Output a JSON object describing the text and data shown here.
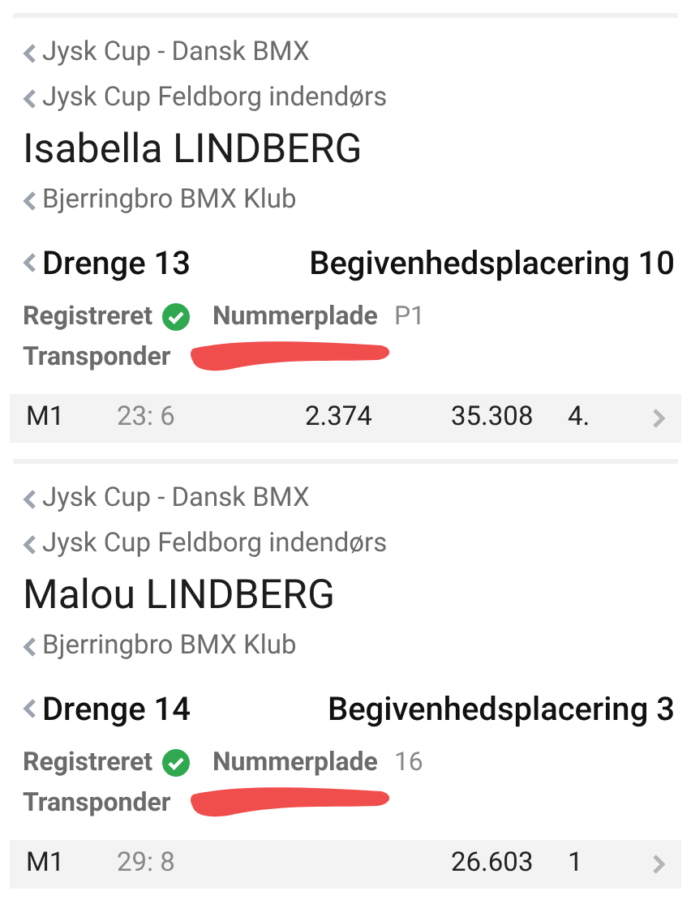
{
  "riders": [
    {
      "breadcrumbs": [
        "Jysk Cup - Dansk BMX",
        "Jysk Cup Feldborg indendørs"
      ],
      "name": "Isabella LINDBERG",
      "club": "Bjerringbro BMX Klub",
      "category": "Drenge 13",
      "placement_label": "Begivenhedsplacering 10",
      "registered_label": "Registreret",
      "registered": true,
      "plate_label": "Nummerplade",
      "plate": "P1",
      "transponder_label": "Transponder",
      "transponder_redacted": true,
      "results": [
        {
          "moto": "M1",
          "gate": "23: 6",
          "column_3": "2.374",
          "time": "35.308",
          "place": "4."
        }
      ]
    },
    {
      "breadcrumbs": [
        "Jysk Cup - Dansk BMX",
        "Jysk Cup Feldborg indendørs"
      ],
      "name": "Malou LINDBERG",
      "club": "Bjerringbro BMX Klub",
      "category": "Drenge 14",
      "placement_label": "Begivenhedsplacering 3",
      "registered_label": "Registreret",
      "registered": true,
      "plate_label": "Nummerplade",
      "plate": "16",
      "transponder_label": "Transponder",
      "transponder_redacted": true,
      "results": [
        {
          "moto": "M1",
          "gate": "29: 8",
          "time": "26.603",
          "place": "1"
        }
      ]
    }
  ]
}
